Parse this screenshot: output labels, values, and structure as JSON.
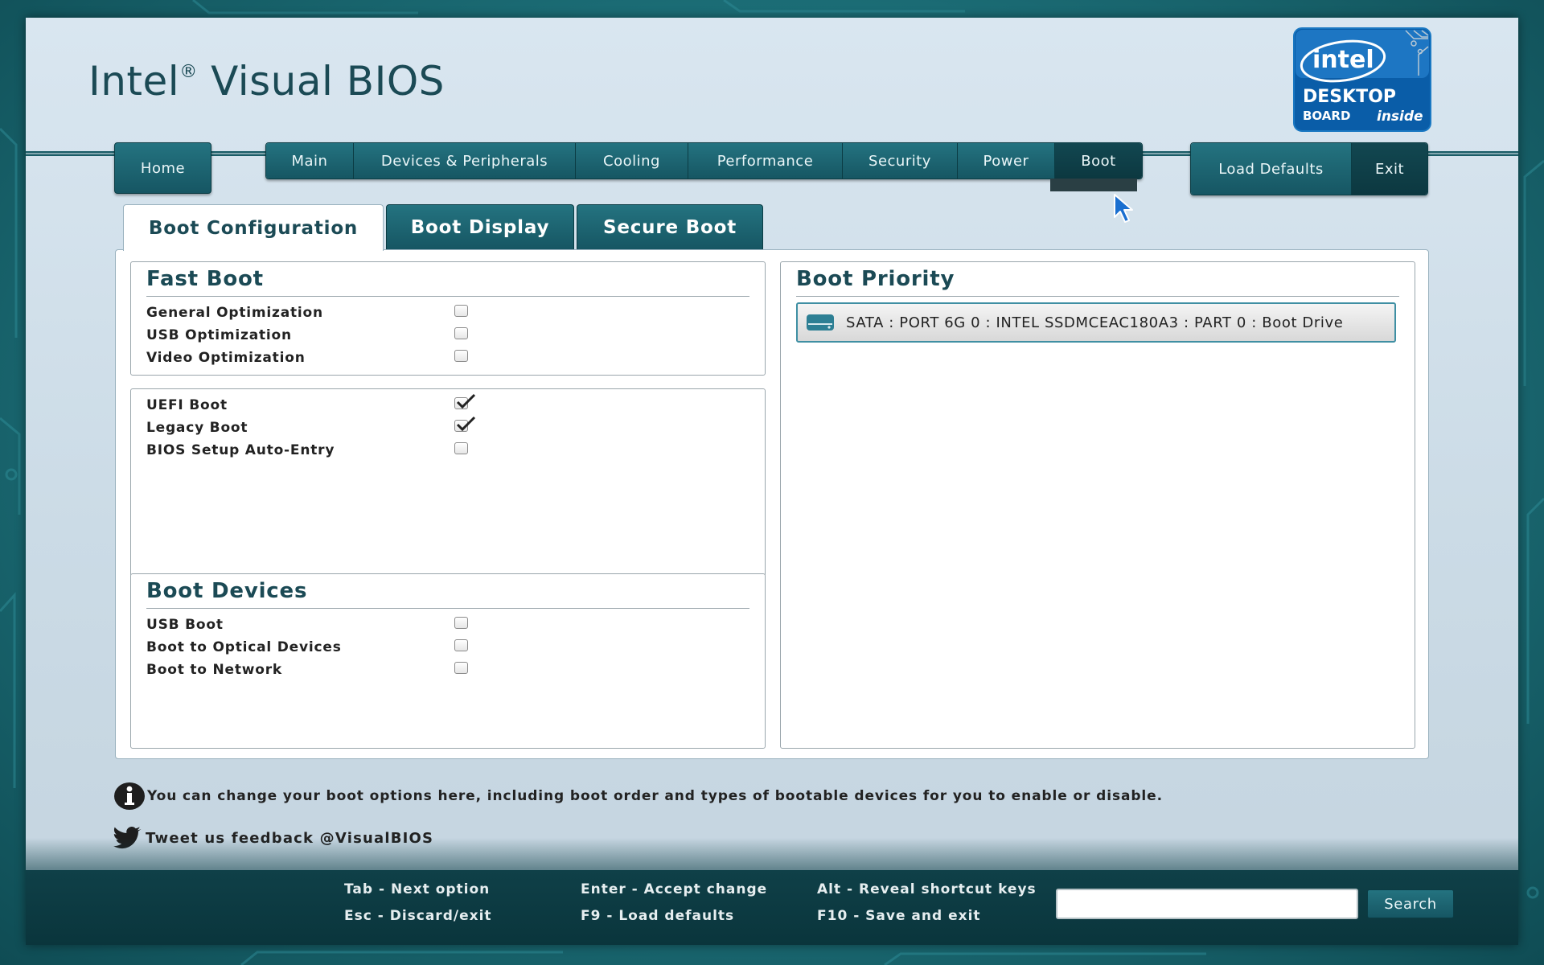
{
  "app": {
    "title": "Intel",
    "title_mark": "®",
    "title_rest": "Visual BIOS"
  },
  "logo": {
    "brand": "intel",
    "line1": "DESKTOP",
    "line2": "BOARD",
    "line3": "inside"
  },
  "nav": {
    "home": "Home",
    "tabs": [
      {
        "label": "Main"
      },
      {
        "label": "Devices & Peripherals"
      },
      {
        "label": "Cooling"
      },
      {
        "label": "Performance"
      },
      {
        "label": "Security"
      },
      {
        "label": "Power"
      },
      {
        "label": "Boot",
        "active": true
      }
    ],
    "load_defaults": "Load Defaults",
    "exit": "Exit"
  },
  "subtabs": [
    {
      "label": "Boot Configuration",
      "active": true
    },
    {
      "label": "Boot Display"
    },
    {
      "label": "Secure Boot"
    }
  ],
  "fast_boot": {
    "title": "Fast Boot",
    "options": [
      {
        "label": "General Optimization",
        "checked": false
      },
      {
        "label": "USB Optimization",
        "checked": false
      },
      {
        "label": "Video Optimization",
        "checked": false
      }
    ]
  },
  "boot_modes": {
    "options": [
      {
        "label": "UEFI Boot",
        "checked": true
      },
      {
        "label": "Legacy Boot",
        "checked": true
      },
      {
        "label": "BIOS Setup Auto-Entry",
        "checked": false
      }
    ]
  },
  "boot_devices": {
    "title": "Boot Devices",
    "options": [
      {
        "label": "USB Boot",
        "checked": false
      },
      {
        "label": "Boot to Optical Devices",
        "checked": false
      },
      {
        "label": "Boot to Network",
        "checked": false
      }
    ]
  },
  "boot_priority": {
    "title": "Boot Priority",
    "items": [
      {
        "label": "SATA : PORT 6G 0 : INTEL SSDMCEAC180A3 : PART 0 : Boot Drive",
        "icon": "drive-icon"
      }
    ]
  },
  "info": {
    "text": "You can change your boot options here, including boot order and types of bootable devices for you to enable or disable.",
    "icon": "info-icon"
  },
  "feedback": {
    "text": "Tweet us feedback @VisualBIOS",
    "icon": "twitter-bird-icon"
  },
  "shortcuts": {
    "tab": "Tab - Next option",
    "esc": "Esc - Discard/exit",
    "enter": "Enter - Accept change",
    "f9": "F9 - Load defaults",
    "alt": "Alt - Reveal shortcut keys",
    "f10": "F10 - Save and exit"
  },
  "search": {
    "value": "",
    "button": "Search"
  },
  "colors": {
    "accent": "#165663",
    "frame": "#d9e6f0",
    "title": "#1b4a55",
    "background": "#1c6e77"
  }
}
